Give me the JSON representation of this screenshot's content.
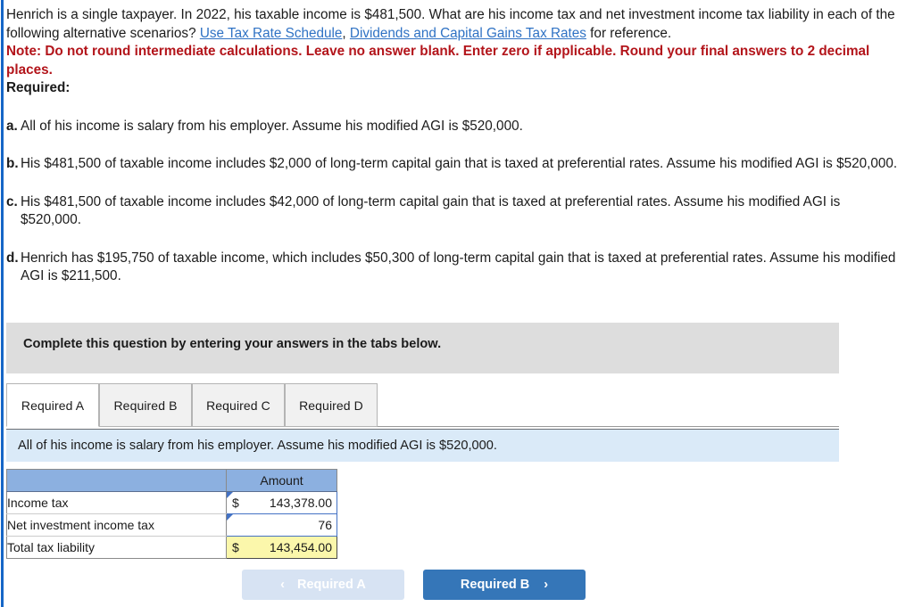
{
  "header": {
    "intro_part1": "Henrich is a single taxpayer. In 2022, his taxable income is $481,500. What are his income tax and net investment income tax liability in each of the following alternative scenarios? ",
    "link1": "Use Tax Rate Schedule",
    "between_links": ", ",
    "link2": "Dividends and Capital Gains Tax Rates",
    "intro_part2": " for reference.",
    "note": "Note: Do not round intermediate calculations. Leave no answer blank. Enter zero if applicable. Round your final answers to 2 decimal places.",
    "required_label": "Required:"
  },
  "scenarios": [
    {
      "bullet": "a.",
      "text": "All of his income is salary from his employer. Assume his modified AGI is $520,000."
    },
    {
      "bullet": "b.",
      "text": "His $481,500 of taxable income includes $2,000 of long-term capital gain that is taxed at preferential rates. Assume his modified AGI is $520,000."
    },
    {
      "bullet": "c.",
      "text": "His $481,500 of taxable income includes $42,000 of long-term capital gain that is taxed at preferential rates. Assume his modified AGI is $520,000."
    },
    {
      "bullet": "d.",
      "text": "Henrich has $195,750 of taxable income, which includes $50,300 of long-term capital gain that is taxed at preferential rates. Assume his modified AGI is $211,500."
    }
  ],
  "complete_bar": {
    "text": "Complete this question by entering your answers in the tabs below."
  },
  "tabs": [
    {
      "label": "Required A",
      "active": true
    },
    {
      "label": "Required B",
      "active": false
    },
    {
      "label": "Required C",
      "active": false
    },
    {
      "label": "Required D",
      "active": false
    }
  ],
  "tab_instruction": {
    "text": "All of his income is salary from his employer. Assume his modified AGI is $520,000."
  },
  "answer_table": {
    "headers": [
      "",
      "Amount"
    ],
    "rows": [
      {
        "label": "Income tax",
        "currency": "$",
        "value": "143,378.00",
        "kind": "input"
      },
      {
        "label": "Net investment income tax",
        "currency": "",
        "value": "76",
        "kind": "input"
      },
      {
        "label": "Total tax liability",
        "currency": "$",
        "value": "143,454.00",
        "kind": "total"
      }
    ]
  },
  "nav": {
    "prev_label": "Required A",
    "prev_chevron": "‹",
    "next_label": "Required B",
    "next_chevron": "›"
  },
  "colors": {
    "rail": "#1666c7",
    "link": "#2f72c4",
    "note_red": "#b3151b",
    "gray_bar": "#dddddd",
    "blue_strip": "#daeaf8",
    "table_header_blue": "#8cb0e0",
    "cell_border_blue": "#4472c4",
    "total_yellow": "#fbf7ab",
    "btn_active": "#3576b8",
    "btn_disabled": "#d7e3f3"
  }
}
